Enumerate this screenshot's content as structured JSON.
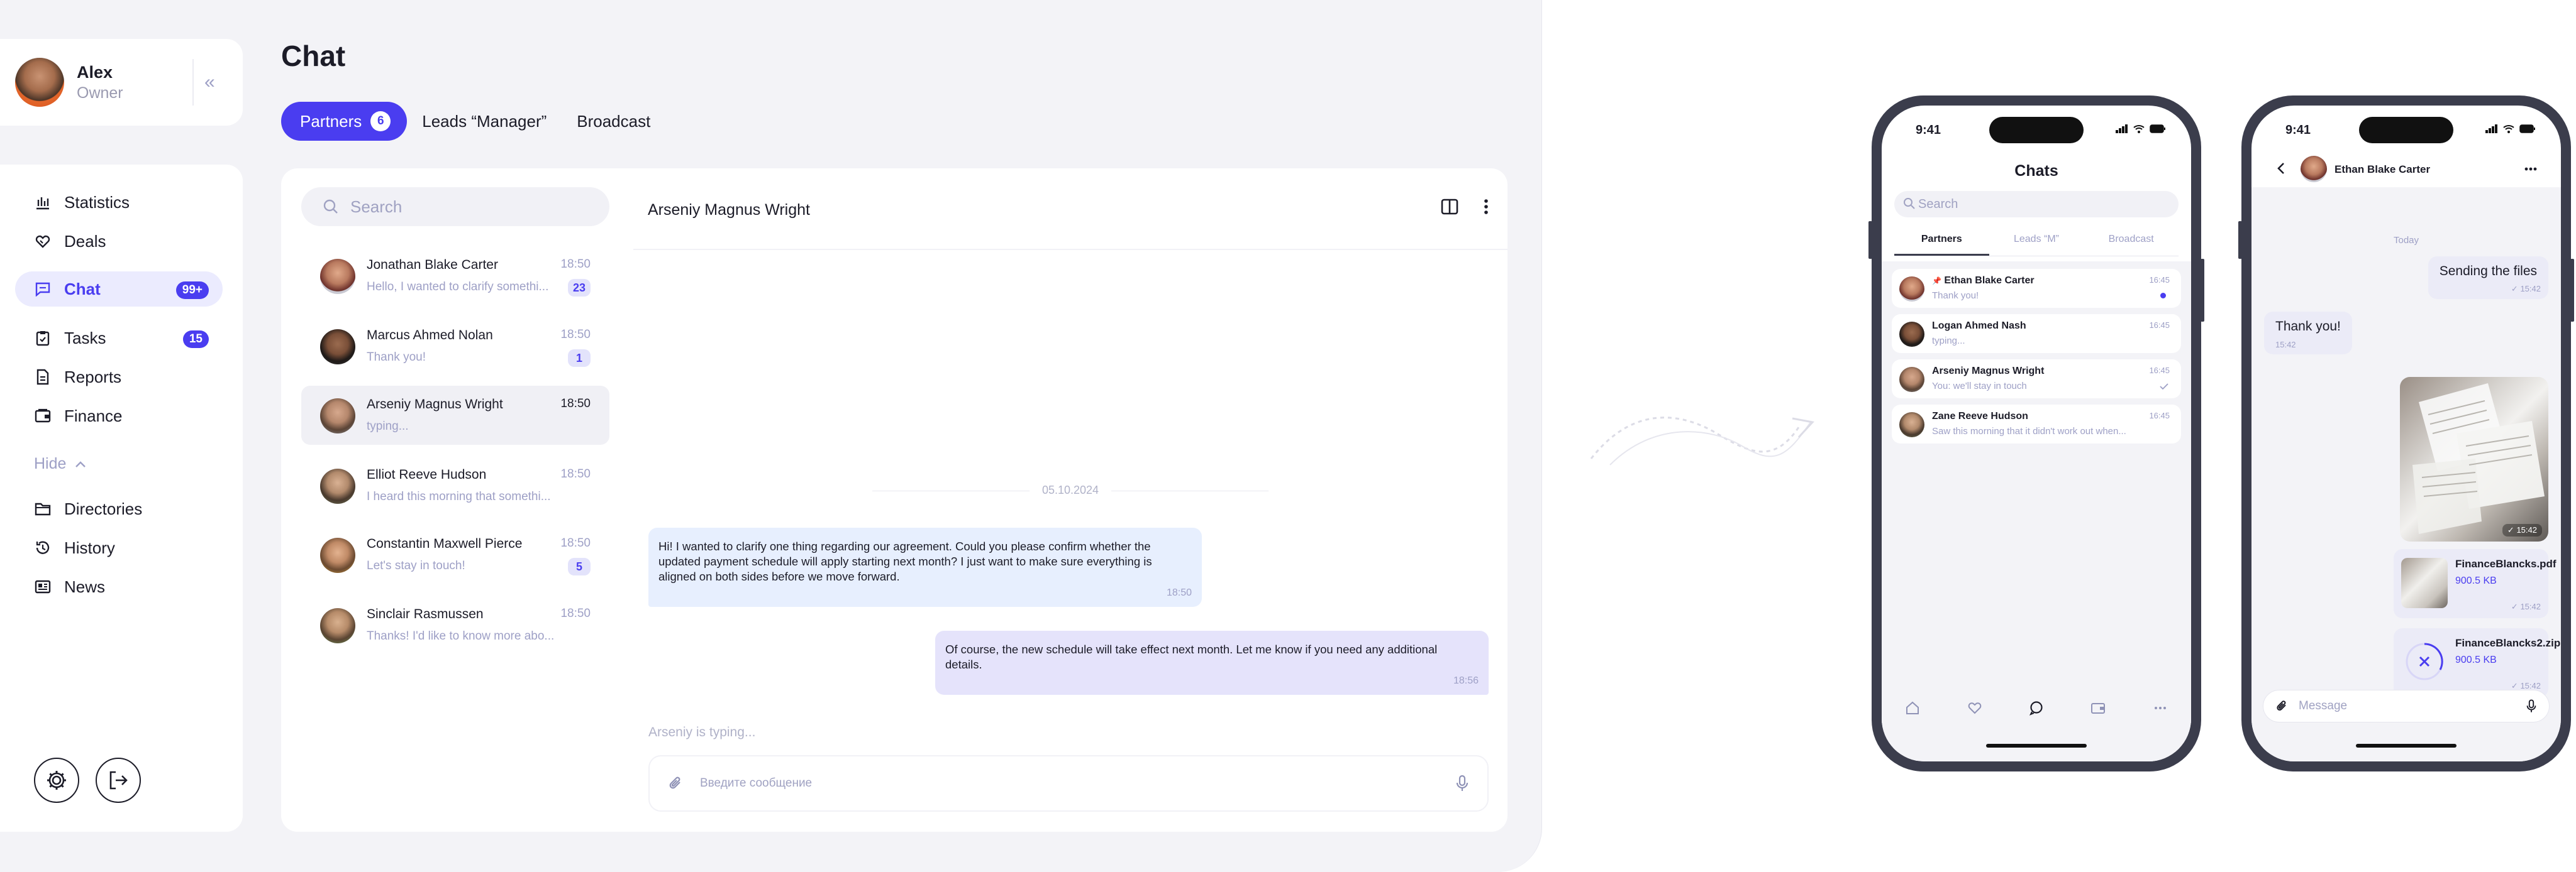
{
  "profile": {
    "name": "Alex",
    "role": "Owner"
  },
  "nav": {
    "items": [
      {
        "label": "Statistics",
        "icon": "bar-chart-icon"
      },
      {
        "label": "Deals",
        "icon": "handshake-icon"
      },
      {
        "label": "Chat",
        "icon": "chat-icon",
        "badge": "99+",
        "active": true
      },
      {
        "label": "Tasks",
        "icon": "clipboard-icon",
        "badge": "15"
      },
      {
        "label": "Reports",
        "icon": "document-icon"
      },
      {
        "label": "Finance",
        "icon": "wallet-icon"
      }
    ],
    "hide_label": "Hide",
    "secondary_items": [
      {
        "label": "Directories",
        "icon": "folder-icon"
      },
      {
        "label": "History",
        "icon": "history-icon"
      },
      {
        "label": "News",
        "icon": "newspaper-icon"
      }
    ]
  },
  "page": {
    "title": "Chat"
  },
  "tabs": [
    {
      "label": "Partners",
      "count": "6",
      "active": true
    },
    {
      "label": "Leads “Manager”"
    },
    {
      "label": "Broadcast"
    }
  ],
  "search": {
    "placeholder": "Search"
  },
  "conversations": [
    {
      "name": "Jonathan Blake Carter",
      "preview": "Hello, I wanted to clarify somethi...",
      "time": "18:50",
      "unread": "23"
    },
    {
      "name": "Marcus Ahmed Nolan",
      "preview": "Thank you!",
      "time": "18:50",
      "unread": "1"
    },
    {
      "name": "Arseniy Magnus Wright",
      "preview": "typing...",
      "time": "18:50",
      "selected": true
    },
    {
      "name": "Elliot Reeve Hudson",
      "preview": "I heard this morning that somethi...",
      "time": "18:50"
    },
    {
      "name": "Constantin Maxwell Pierce",
      "preview": "Let's stay in touch!",
      "time": "18:50",
      "unread": "5"
    },
    {
      "name": "Sinclair Rasmussen",
      "preview": "Thanks! I'd like to know more abo...",
      "time": "18:50"
    }
  ],
  "chat": {
    "name": "Arseniy Magnus Wright",
    "date": "05.10.2024",
    "messages": [
      {
        "dir": "in",
        "text": "Hi! I wanted to clarify one thing regarding our agreement. Could you please confirm whether the updated payment schedule will apply starting next month? I just want to make sure everything is aligned on both sides before we move forward.",
        "time": "18:50"
      },
      {
        "dir": "out",
        "text": "Of course, the new schedule will take effect next month. Let me know if you need any additional details.",
        "time": "18:56"
      }
    ],
    "typing": "Arseniy is typing...",
    "composer_placeholder": "Введите сообщение"
  },
  "phone1": {
    "status_time": "9:41",
    "title": "Chats",
    "search_placeholder": "Search",
    "tabs": [
      "Partners",
      "Leads “M”",
      "Broadcast"
    ],
    "conversations": [
      {
        "name": "Ethan Blake Carter",
        "preview": "Thank you!",
        "time": "16:45",
        "pinned": true,
        "unread_dot": true
      },
      {
        "name": "Logan Ahmed Nash",
        "preview": "typing...",
        "time": "16:45"
      },
      {
        "name": "Arseniy Magnus Wright",
        "preview": "You: we'll stay in touch",
        "time": "16:45",
        "read": true
      },
      {
        "name": "Zane Reeve Hudson",
        "preview": "Saw this morning that it didn't work out when...",
        "time": "16:45"
      }
    ]
  },
  "phone2": {
    "status_time": "9:41",
    "contact": "Ethan Blake Carter",
    "today": "Today",
    "messages": [
      {
        "dir": "out",
        "text": "Sending the files",
        "time": "15:42"
      },
      {
        "dir": "in",
        "text": "Thank you!",
        "time": "15:42"
      }
    ],
    "photo_time": "15:42",
    "files": [
      {
        "name": "FinanceBlancks.pdf",
        "size": "900.5 KB",
        "time": "15:42"
      },
      {
        "name": "FinanceBlancks2.zip",
        "size": "900.5 KB",
        "time": "15:42"
      }
    ],
    "composer_placeholder": "Message"
  },
  "colors": {
    "accent": "#4a3df0",
    "bg": "#f3f3f7",
    "bubble_in": "#e7effe",
    "bubble_out": "#e5e3fb",
    "muted": "#9ea0c6"
  }
}
